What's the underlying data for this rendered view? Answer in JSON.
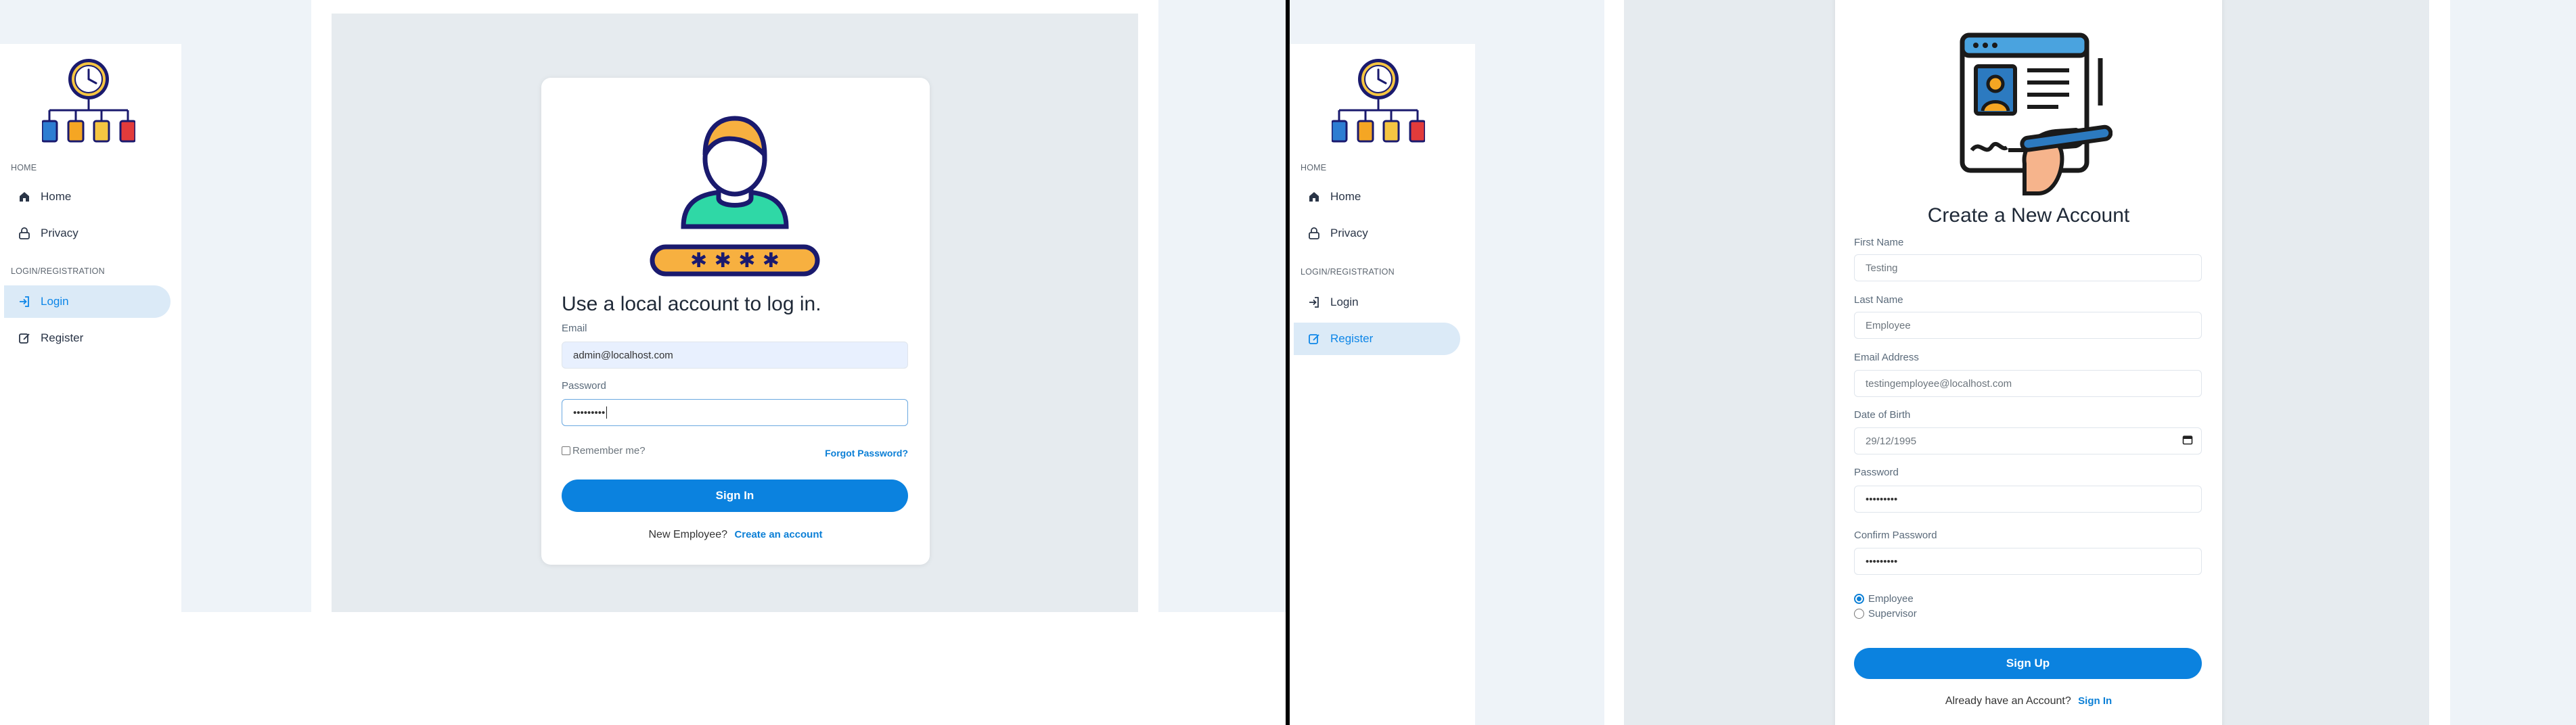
{
  "login_page": {
    "nav": {
      "section_home": "HOME",
      "home": "Home",
      "privacy": "Privacy",
      "section_auth": "LOGIN/REGISTRATION",
      "login": "Login",
      "register": "Register",
      "active": "login"
    },
    "form": {
      "title": "Use a local account to log in.",
      "email_label": "Email",
      "email_value": "admin@localhost.com",
      "password_label": "Password",
      "password_value": "•••••••••",
      "remember_label": "Remember me?",
      "forgot_link": "Forgot Password?",
      "sign_in_button": "Sign In",
      "new_employee_text": "New Employee?",
      "create_account_link": "Create an account"
    }
  },
  "register_page": {
    "nav": {
      "section_home": "HOME",
      "home": "Home",
      "privacy": "Privacy",
      "section_auth": "LOGIN/REGISTRATION",
      "login": "Login",
      "register": "Register",
      "active": "register"
    },
    "form": {
      "title": "Create a New Account",
      "first_name_label": "First Name",
      "first_name_value": "Testing",
      "last_name_label": "Last Name",
      "last_name_value": "Employee",
      "email_label": "Email Address",
      "email_value": "testingemployee@localhost.com",
      "dob_label": "Date of Birth",
      "dob_value": "29/12/1995",
      "password_label": "Password",
      "password_value": "•••••••••",
      "confirm_password_label": "Confirm Password",
      "confirm_password_value": "•••••••••",
      "role_options": [
        "Employee",
        "Supervisor"
      ],
      "role_selected": "Employee",
      "sign_up_button": "Sign Up",
      "have_account_text": "Already have an Account?",
      "sign_in_link": "Sign In"
    }
  },
  "colors": {
    "accent": "#0b82df",
    "active_nav_bg": "#dbeaf7",
    "page_bg": "#eef3f8",
    "content_bg": "#e6ebef"
  }
}
